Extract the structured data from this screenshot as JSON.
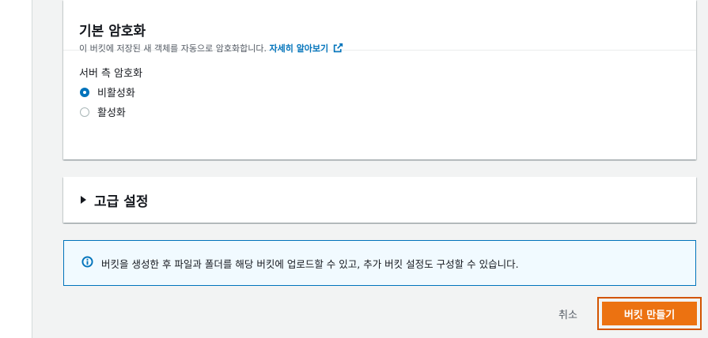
{
  "encryption": {
    "title": "기본 암호화",
    "description": "이 버킷에 저장된 새 객체를 자동으로 암호화합니다.",
    "learn_more": "자세히 알아보기",
    "field_label": "서버 측 암호화",
    "options": [
      {
        "label": "비활성화",
        "selected": true
      },
      {
        "label": "활성화",
        "selected": false
      }
    ]
  },
  "advanced": {
    "title": "고급 설정",
    "expanded": false
  },
  "info": {
    "message": "버킷을 생성한 후 파일과 폴더를 해당 버킷에 업로드할 수 있고, 추가 버킷 설정도 구성할 수 있습니다."
  },
  "footer": {
    "cancel_label": "취소",
    "create_label": "버킷 만들기"
  },
  "colors": {
    "accent": "#0073bb",
    "primary_button": "#ec7211",
    "highlight_border": "#d35400"
  },
  "icons": {
    "external_link": "external-link-icon",
    "info": "info-icon",
    "expand": "caret-right-icon"
  }
}
